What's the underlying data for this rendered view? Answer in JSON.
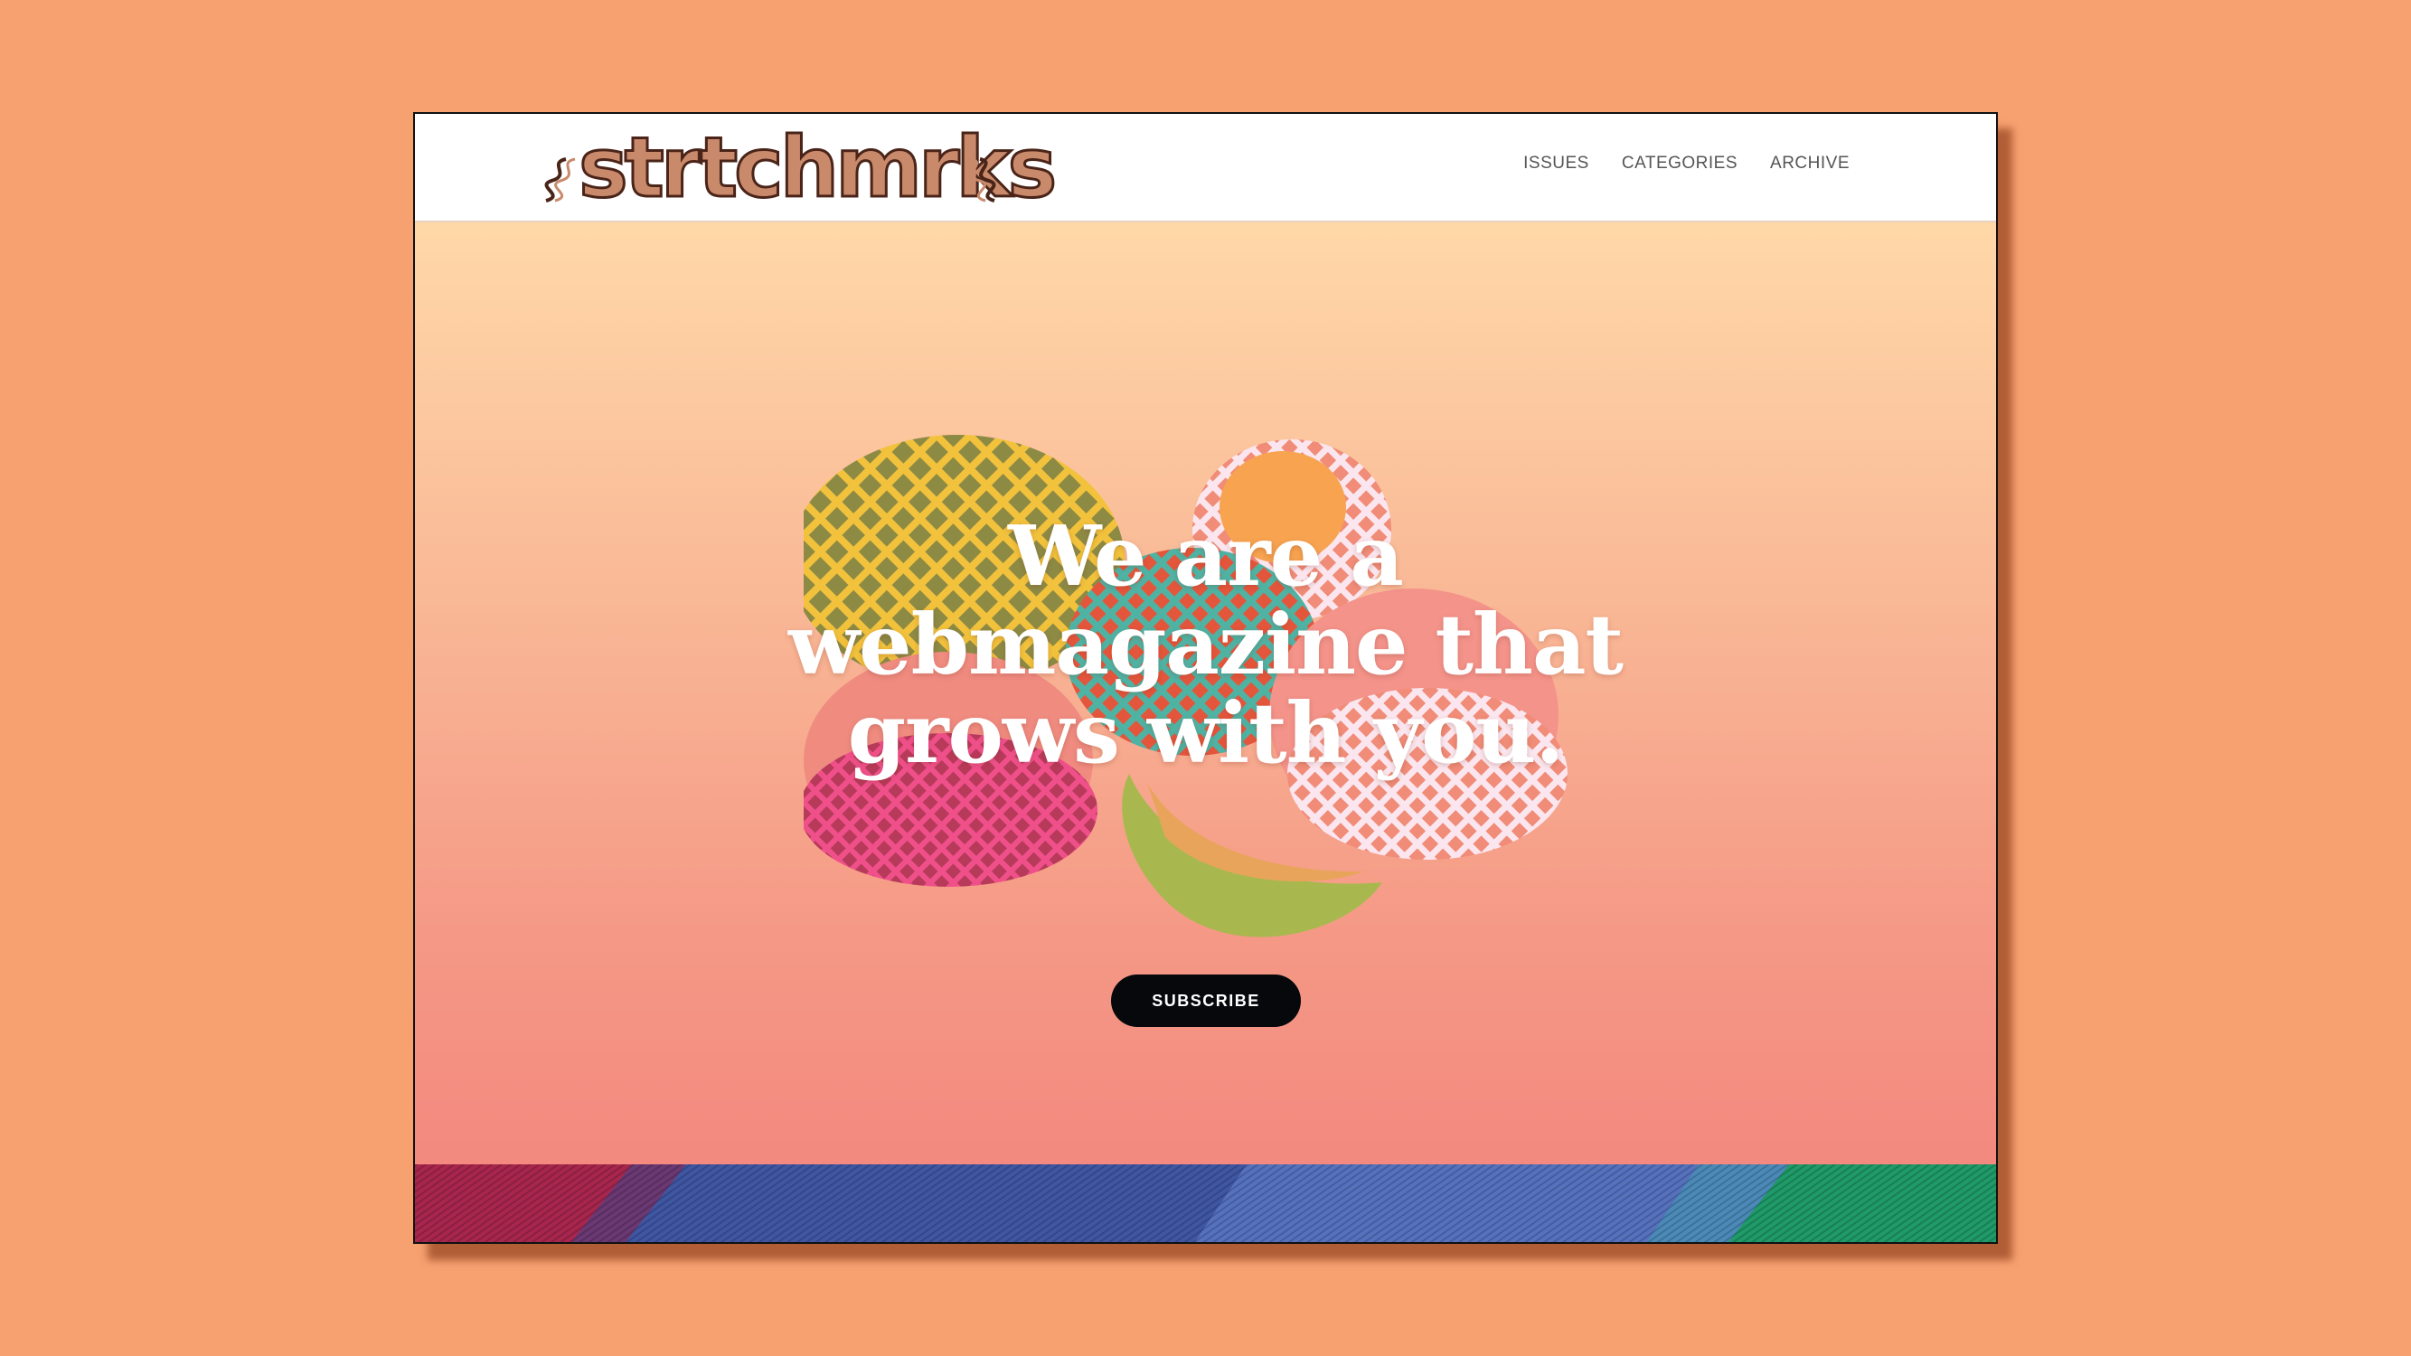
{
  "header": {
    "logo_text": "strtchmrks",
    "nav": [
      "ISSUES",
      "CATEGORIES",
      "ARCHIVE"
    ]
  },
  "hero": {
    "title_lines": [
      "We are a",
      "webmagazine that",
      "grows with you."
    ],
    "subscribe_label": "SUBSCRIBE"
  },
  "colors": {
    "page_background": "#f7a070",
    "hero_gradient_top": "#ffd8a8",
    "hero_gradient_bottom": "#f3897f",
    "button_background": "#06080b",
    "logo_fill": "#c98a6c"
  },
  "icons": [
    "logo-wave-icon"
  ]
}
